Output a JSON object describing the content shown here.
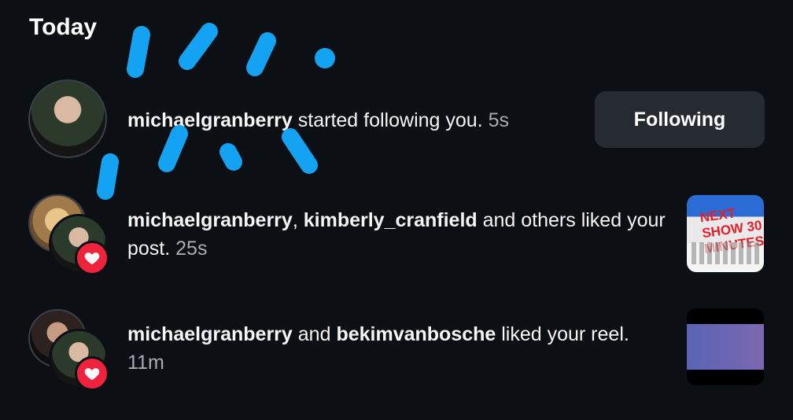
{
  "section": {
    "title": "Today"
  },
  "notifications": [
    {
      "user": "michaelgranberry",
      "text": " started following you.",
      "time": "5s",
      "button_label": "Following"
    },
    {
      "users": [
        "michaelgranberry",
        "kimberly_cranfield"
      ],
      "separator": ", ",
      "text": " and others liked your post.",
      "time": "25s",
      "thumbnail_text": "NEXT SHOW 30 MINUTES"
    },
    {
      "users": [
        "michaelgranberry",
        "bekimvanbosche"
      ],
      "separator": " and ",
      "text": " liked your reel.",
      "time": "11m"
    }
  ],
  "colors": {
    "background": "#0c0f14",
    "button_bg": "#262a31",
    "heart": "#f0233d",
    "annotation": "#13a3f2"
  },
  "icons": [
    "heart-icon"
  ]
}
